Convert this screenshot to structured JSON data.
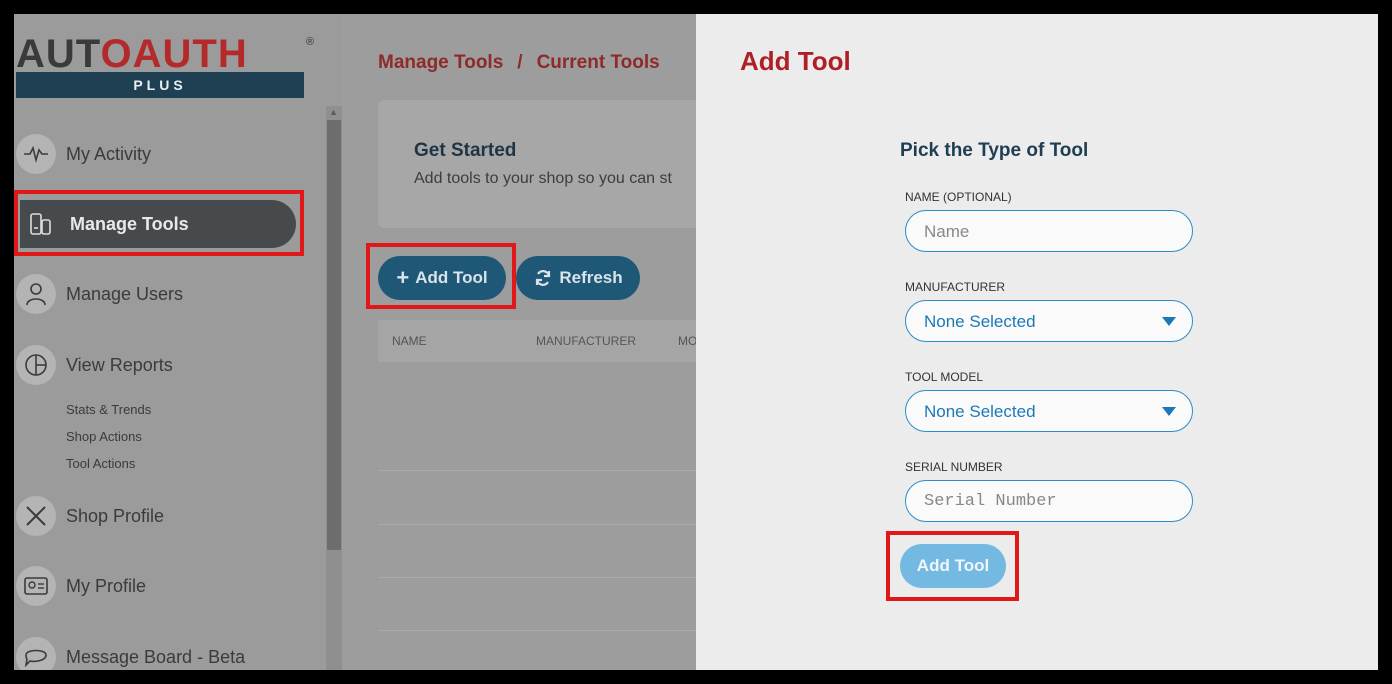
{
  "logo": {
    "word_left": "AUT",
    "word_mid": "AUTH",
    "sub": "PLUS",
    "reg": "®"
  },
  "sidebar": {
    "items": [
      {
        "label": "My Activity",
        "icon": "activity-icon"
      },
      {
        "label": "Manage Tools",
        "icon": "tools-icon",
        "active": true
      },
      {
        "label": "Manage Users",
        "icon": "users-icon"
      },
      {
        "label": "View Reports",
        "icon": "reports-icon"
      },
      {
        "label": "Shop Profile",
        "icon": "wrench-icon"
      },
      {
        "label": "My Profile",
        "icon": "id-card-icon"
      },
      {
        "label": "Message Board - Beta",
        "icon": "chat-icon"
      }
    ],
    "subitems": [
      "Stats & Trends",
      "Shop Actions",
      "Tool Actions"
    ]
  },
  "main": {
    "breadcrumb": {
      "first": "Manage Tools",
      "sep": "/",
      "second": "Current Tools"
    },
    "card": {
      "title": "Get Started",
      "text": "Add tools to your shop so you can st"
    },
    "add_button": "Add Tool",
    "refresh_button": "Refresh",
    "table": {
      "headers": [
        "NAME",
        "MANUFACTURER",
        "MO"
      ]
    }
  },
  "panel": {
    "title": "Add Tool",
    "form_title": "Pick the Type of Tool",
    "fields": [
      {
        "label": "NAME (OPTIONAL)",
        "placeholder": "Name"
      },
      {
        "label": "MANUFACTURER",
        "value": "None Selected"
      },
      {
        "label": "TOOL MODEL",
        "value": "None Selected"
      },
      {
        "label": "SERIAL NUMBER",
        "placeholder": "Serial Number"
      }
    ],
    "submit": "Add Tool"
  },
  "colors": {
    "brand_red": "#b01e26",
    "navy": "#1f3f52",
    "button_blue": "#1f5777",
    "highlight": "#e01818"
  }
}
